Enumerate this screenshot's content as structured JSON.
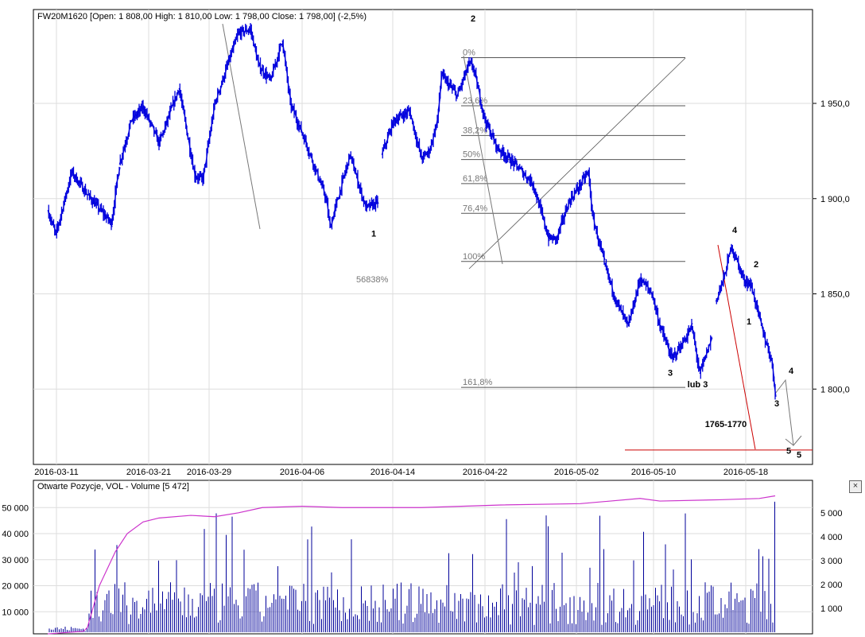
{
  "header": {
    "title": "FW20M1620 [Open: 1 808,00  High: 1 810,00  Low: 1 798,00  Close: 1 798,00] (-2,5%)"
  },
  "volume_panel": {
    "title": "Otwarte Pozycje, VOL - Volume [5 472]",
    "close_icon": "close-icon",
    "close_label": "×"
  },
  "colors": {
    "price": "#0000dd",
    "oi": "#cc33cc",
    "volume": "#00009a",
    "annotation_red": "#cc0000",
    "annotation_gray": "#777777",
    "grid": "#dddddd"
  },
  "chart_data": [
    {
      "type": "line",
      "title": "FW20M1620",
      "ylim": [
        1765,
        1995
      ],
      "y_ticks": [
        {
          "v": 1950,
          "label": "1 950,0"
        },
        {
          "v": 1900,
          "label": "1 900,0"
        },
        {
          "v": 1850,
          "label": "1 850,0"
        },
        {
          "v": 1800,
          "label": "1 800,0"
        }
      ],
      "x_ticks": [
        {
          "bar": 3.2,
          "label": "2016-03-11"
        },
        {
          "bar": 26.4,
          "label": "2016-03-21"
        },
        {
          "bar": 41.6,
          "label": "2016-03-29"
        },
        {
          "bar": 65,
          "label": "2016-04-06"
        },
        {
          "bar": 87.8,
          "label": "2016-04-14"
        },
        {
          "bar": 111,
          "label": "2016-04-22"
        },
        {
          "bar": 134,
          "label": "2016-05-02"
        },
        {
          "bar": 153.4,
          "label": "2016-05-10"
        },
        {
          "bar": 176.6,
          "label": "2016-05-18"
        }
      ],
      "price_path": [
        [
          1,
          1894
        ],
        [
          3,
          1881
        ],
        [
          7,
          1914
        ],
        [
          11,
          1902
        ],
        [
          17,
          1887
        ],
        [
          19,
          1918
        ],
        [
          22,
          1941
        ],
        [
          25,
          1948
        ],
        [
          29,
          1929
        ],
        [
          34,
          1958
        ],
        [
          38,
          1912
        ],
        [
          40,
          1910
        ],
        [
          43,
          1950
        ],
        [
          47,
          1975
        ],
        [
          49,
          1987
        ],
        [
          52,
          1989
        ],
        [
          54,
          1970
        ],
        [
          57,
          1962
        ],
        [
          60,
          1983
        ],
        [
          62,
          1950
        ],
        [
          66,
          1929
        ],
        [
          71,
          1900
        ],
        [
          72,
          1885
        ],
        [
          77,
          1923
        ],
        [
          81,
          1895
        ],
        [
          84,
          1898
        ],
        [
          85,
          1923
        ],
        [
          88,
          1941
        ],
        [
          92,
          1946
        ],
        [
          95,
          1921
        ],
        [
          97,
          1925
        ],
        [
          99,
          1941
        ],
        [
          100,
          1965
        ],
        [
          104,
          1954
        ],
        [
          107,
          1971
        ],
        [
          108,
          1969
        ],
        [
          111,
          1941
        ],
        [
          114,
          1927
        ],
        [
          119,
          1917
        ],
        [
          123,
          1908
        ],
        [
          127,
          1879
        ],
        [
          129,
          1879
        ],
        [
          132,
          1898
        ],
        [
          137,
          1914
        ],
        [
          138,
          1891
        ],
        [
          141,
          1866
        ],
        [
          144,
          1846
        ],
        [
          147,
          1833
        ],
        [
          150,
          1858
        ],
        [
          153,
          1850
        ],
        [
          155,
          1833
        ],
        [
          158,
          1816
        ],
        [
          161,
          1825
        ],
        [
          163,
          1833
        ],
        [
          165,
          1808
        ],
        [
          168,
          1827
        ],
        [
          169,
          1846
        ],
        [
          171,
          1858
        ],
        [
          173,
          1875
        ],
        [
          176,
          1858
        ],
        [
          178,
          1854
        ],
        [
          181,
          1829
        ],
        [
          183,
          1816
        ],
        [
          184,
          1798
        ]
      ],
      "fibonacci": {
        "high": 1974,
        "low": 1867,
        "levels": [
          {
            "r": 0,
            "label": "0%"
          },
          {
            "r": 0.236,
            "label": "23,6%"
          },
          {
            "r": 0.382,
            "label": "38,2%"
          },
          {
            "r": 0.5,
            "label": "50%"
          },
          {
            "r": 0.618,
            "label": "61,8%"
          },
          {
            "r": 0.764,
            "label": "76,4%"
          },
          {
            "r": 1,
            "label": "100%"
          },
          {
            "r": 1.618,
            "label": "161,8%"
          }
        ]
      },
      "stray_label": "56838%",
      "target_line": 1768,
      "annotations_red": [
        {
          "bar": 108,
          "p": 1993,
          "label": "2"
        },
        {
          "bar": 83,
          "p": 1880,
          "label": "1"
        },
        {
          "bar": 157.6,
          "p": 1807,
          "label": "3"
        },
        {
          "bar": 164.5,
          "p": 1801,
          "label": "lub 3"
        },
        {
          "bar": 173.8,
          "p": 1882,
          "label": "4"
        },
        {
          "bar": 190,
          "p": 1764,
          "label": "5"
        }
      ],
      "annotations_gray": [
        {
          "bar": 179.2,
          "p": 1864,
          "label": "2"
        },
        {
          "bar": 177.4,
          "p": 1834,
          "label": "1"
        },
        {
          "bar": 184.4,
          "p": 1791,
          "label": "3"
        },
        {
          "bar": 188,
          "p": 1808,
          "label": "4"
        },
        {
          "bar": 187.4,
          "p": 1766,
          "label": "5"
        },
        {
          "bar": 171.6,
          "p": 1780,
          "label": "1765-1770"
        }
      ]
    },
    {
      "type": "bar",
      "title": "Otwarte Pozycje, VOL - Volume",
      "left_ticks": [
        "50 000",
        "40 000",
        "30 000",
        "20 000",
        "10 000"
      ],
      "right_ticks": [
        "5 000",
        "4 000",
        "3 000",
        "2 000",
        "1 000"
      ],
      "last_volume": 5472,
      "open_interest_path": [
        [
          1,
          1500
        ],
        [
          10,
          2500
        ],
        [
          11,
          4000
        ],
        [
          14,
          20000
        ],
        [
          18,
          33000
        ],
        [
          21,
          40000
        ],
        [
          25,
          44500
        ],
        [
          29,
          46000
        ],
        [
          37,
          47000
        ],
        [
          43,
          46500
        ],
        [
          49,
          48000
        ],
        [
          55,
          50000
        ],
        [
          65,
          50500
        ],
        [
          75,
          50000
        ],
        [
          95,
          50000
        ],
        [
          115,
          51000
        ],
        [
          135,
          51500
        ],
        [
          150,
          53500
        ],
        [
          155,
          52500
        ],
        [
          170,
          53000
        ],
        [
          180,
          53500
        ],
        [
          184,
          54500
        ]
      ]
    }
  ]
}
